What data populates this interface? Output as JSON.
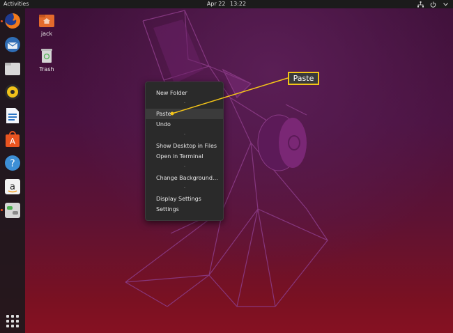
{
  "topbar": {
    "activities": "Activities",
    "date": "Apr 22",
    "time": "13:22"
  },
  "tray_icons": [
    "network-icon",
    "power-icon",
    "chevron-down-icon"
  ],
  "dock": {
    "items": [
      "firefox-icon",
      "thunderbird-icon",
      "files-icon",
      "rhythmbox-icon",
      "libreoffice-writer-icon",
      "ubuntu-software-icon",
      "help-icon",
      "amazon-icon",
      "toggle-settings-icon"
    ],
    "show_apps_icon": "grid-icon"
  },
  "desktop_icons": [
    {
      "label": "jack",
      "icon": "home-folder-icon"
    },
    {
      "label": "Trash",
      "icon": "trash-icon"
    }
  ],
  "context_menu": {
    "items": [
      "New Folder",
      "Paste",
      "Undo",
      "Show Desktop in Files",
      "Open in Terminal",
      "Change Background…",
      "Display Settings",
      "Settings"
    ],
    "highlighted": "Paste"
  },
  "callout": {
    "label": "Paste"
  },
  "colors": {
    "accent": "#f5c518",
    "ubuntu_orange": "#e95420",
    "menu_bg": "#2a2a2a"
  }
}
